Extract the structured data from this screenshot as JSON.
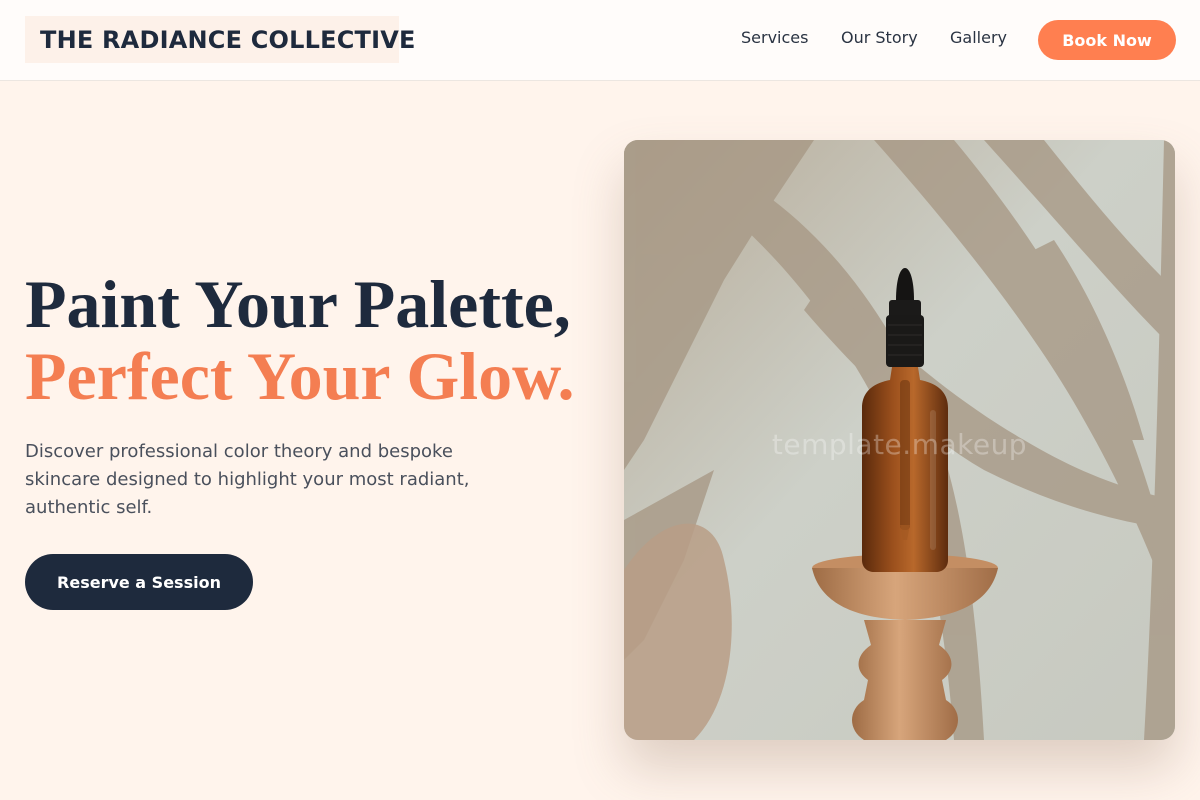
{
  "header": {
    "brand": "THE RADIANCE COLLECTIVE",
    "nav": [
      "Services",
      "Our Story",
      "Gallery"
    ],
    "cta": "Book Now"
  },
  "hero": {
    "title_line1": "Paint Your Palette,",
    "title_line2": "Perfect Your Glow.",
    "description": "Discover professional color theory and bespoke skincare designed to highlight your most radiant, authentic self.",
    "cta": "Reserve a Session"
  },
  "image": {
    "watermark": "template.makeup",
    "subject_icon": "dropper-bottle-on-pedestal"
  },
  "colors": {
    "accent": "#ff7f50",
    "navy": "#1e2a3d",
    "background": "#fff4ec"
  }
}
